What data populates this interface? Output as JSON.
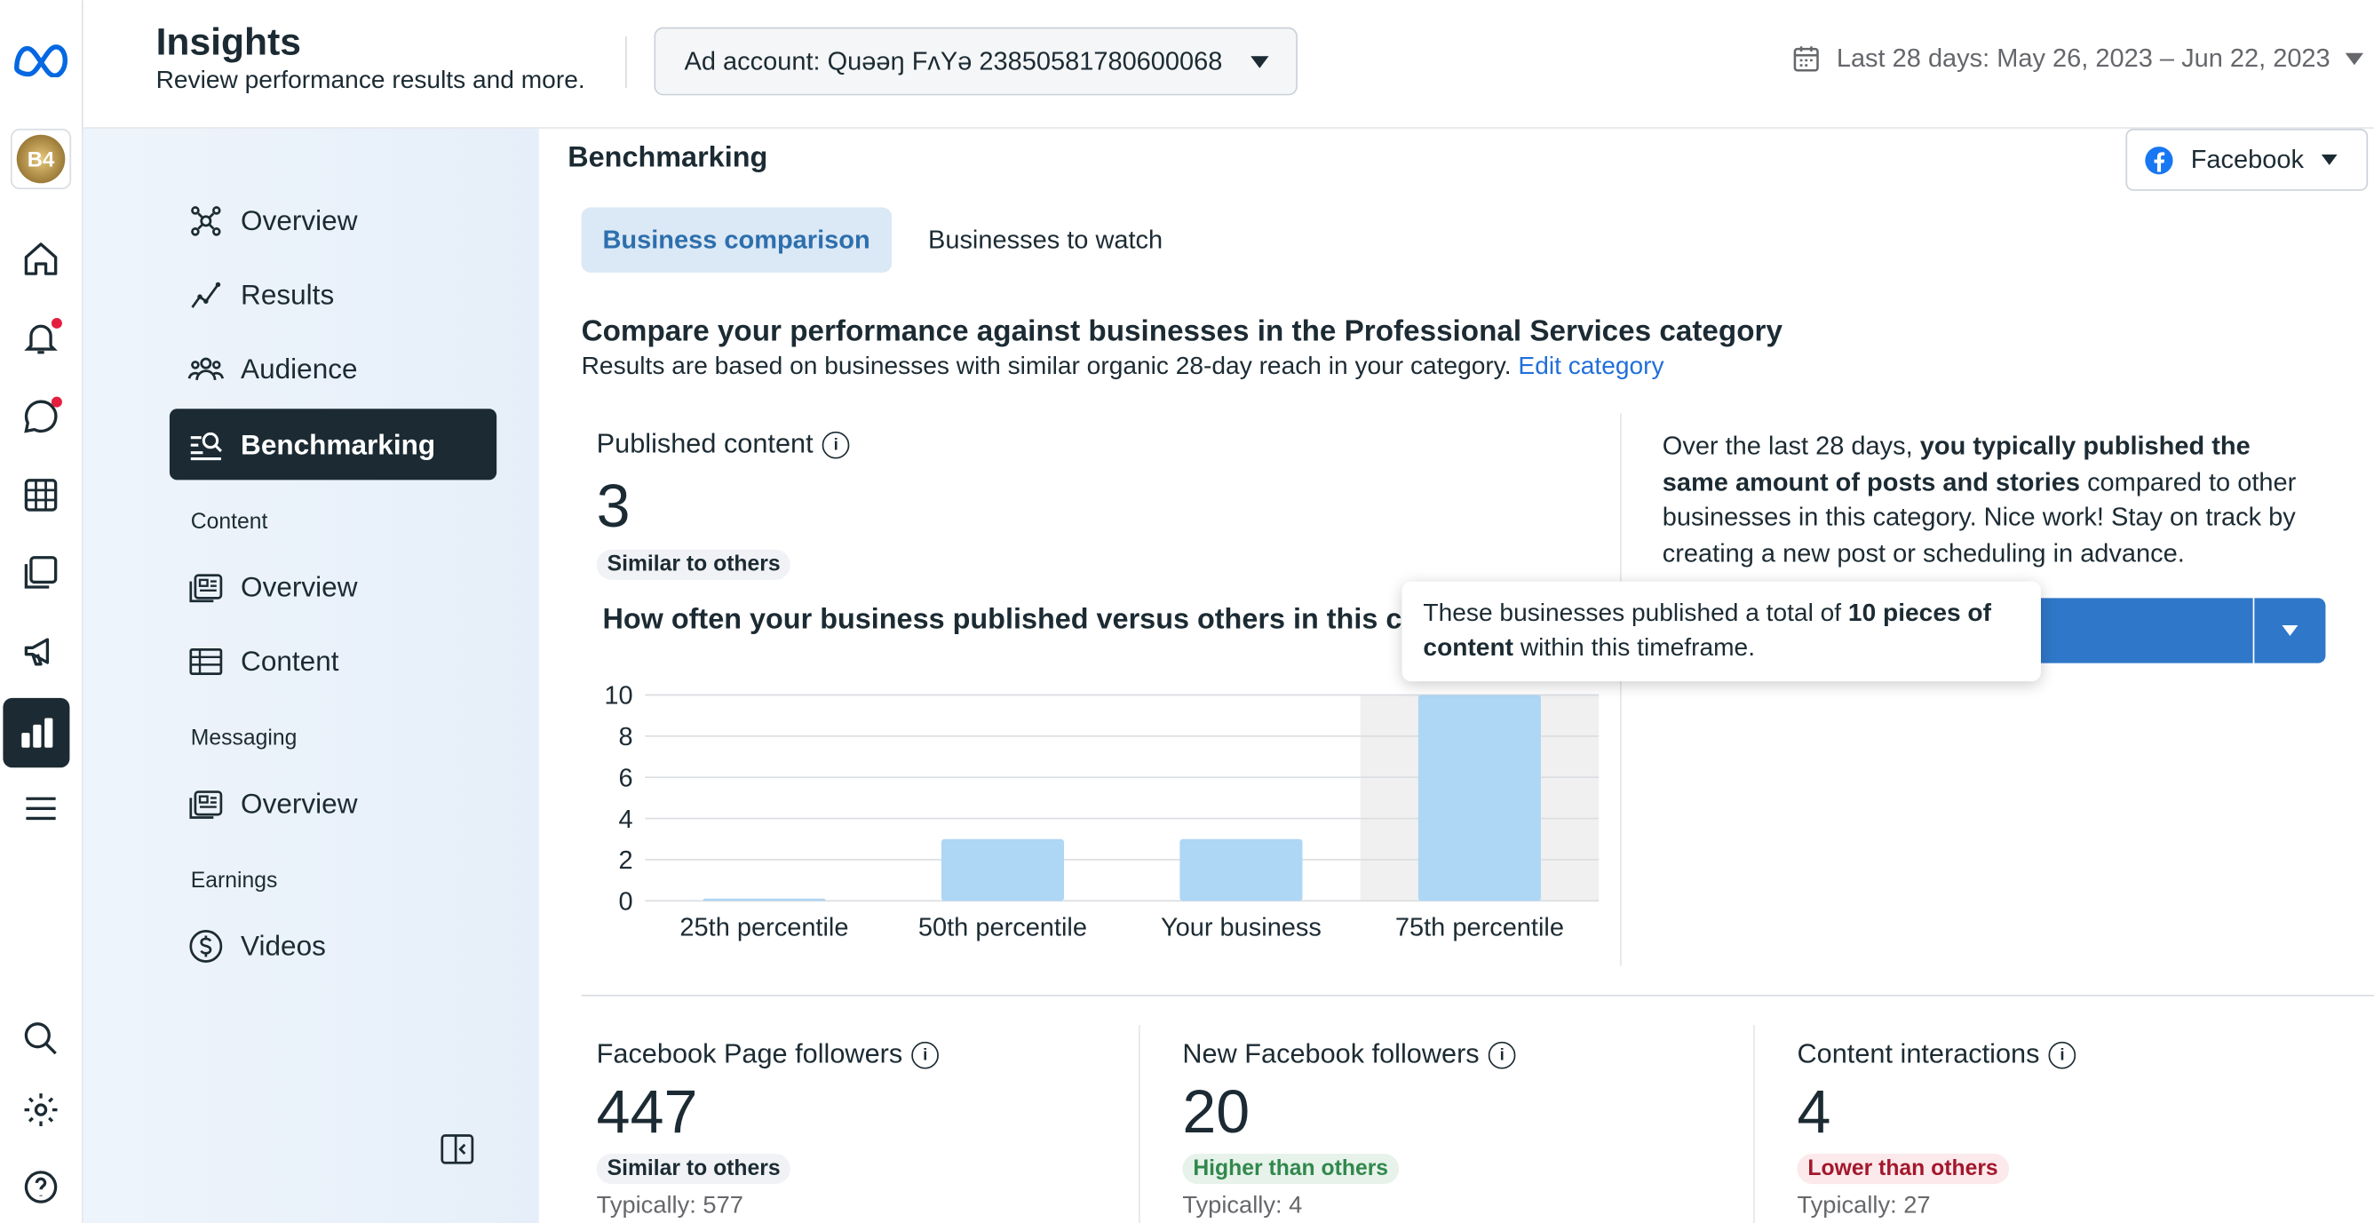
{
  "header": {
    "title": "Insights",
    "subtitle": "Review performance results and more.",
    "account": "Ad account: Quəəŋ FʌYə 23850581780600068",
    "date_range": "Last 28 days: May 26, 2023 – Jun 22, 2023"
  },
  "rail": {
    "icons": [
      "meta-logo-icon",
      "avatar",
      "home-icon",
      "bell-icon",
      "chat-icon",
      "table-icon",
      "pages-icon",
      "megaphone-icon",
      "insights-icon",
      "menu-icon",
      "search-icon",
      "gear-icon",
      "help-icon"
    ],
    "avatar_text": "B4"
  },
  "nav": {
    "items": [
      {
        "label": "Overview",
        "icon": "network-icon"
      },
      {
        "label": "Results",
        "icon": "trend-icon"
      },
      {
        "label": "Audience",
        "icon": "people-icon"
      },
      {
        "label": "Benchmarking",
        "icon": "benchmark-icon",
        "active": true
      }
    ],
    "content_section": "Content",
    "content_items": [
      {
        "label": "Overview"
      },
      {
        "label": "Content"
      }
    ],
    "messaging_section": "Messaging",
    "messaging_items": [
      {
        "label": "Overview"
      }
    ],
    "earnings_section": "Earnings",
    "earnings_items": [
      {
        "label": "Videos"
      }
    ]
  },
  "main": {
    "title": "Benchmarking",
    "platform": "Facebook",
    "tabs": [
      "Business comparison",
      "Businesses to watch"
    ],
    "compare_heading": "Compare your performance against businesses in the Professional Services category",
    "compare_sub": "Results are based on businesses with similar organic 28-day reach in your category.",
    "edit_link": "Edit category",
    "published": {
      "label": "Published content",
      "value": "3",
      "badge": "Similar to others"
    },
    "chart_heading": "How often your business published versus others in this category",
    "insight_prefix": "Over the last 28 days, ",
    "insight_bold": "you typically published the same amount of posts and stories",
    "insight_suffix": " compared to other businesses in this category. Nice work! Stay on track by creating a new post or scheduling in advance.",
    "tooltip_prefix": "These businesses published a total of ",
    "tooltip_bold": "10 pieces of content",
    "tooltip_suffix": " within this timeframe.",
    "metrics": [
      {
        "label": "Facebook Page followers",
        "value": "447",
        "badge": "Similar to others",
        "badge_type": "neutral",
        "typical": "Typically: 577"
      },
      {
        "label": "New Facebook followers",
        "value": "20",
        "badge": "Higher than others",
        "badge_type": "green",
        "typical": "Typically: 4"
      },
      {
        "label": "Content interactions",
        "value": "4",
        "badge": "Lower than others",
        "badge_type": "red",
        "typical": "Typically: 27"
      }
    ]
  },
  "chart_data": {
    "type": "bar",
    "categories": [
      "25th percentile",
      "50th percentile",
      "Your business",
      "75th percentile"
    ],
    "values": [
      0,
      3,
      3,
      10
    ],
    "ylim": [
      0,
      10
    ],
    "yticks": [
      0,
      2,
      4,
      6,
      8,
      10
    ],
    "highlighted": "75th percentile",
    "bar_color": "#aed6f5",
    "grid": true
  }
}
